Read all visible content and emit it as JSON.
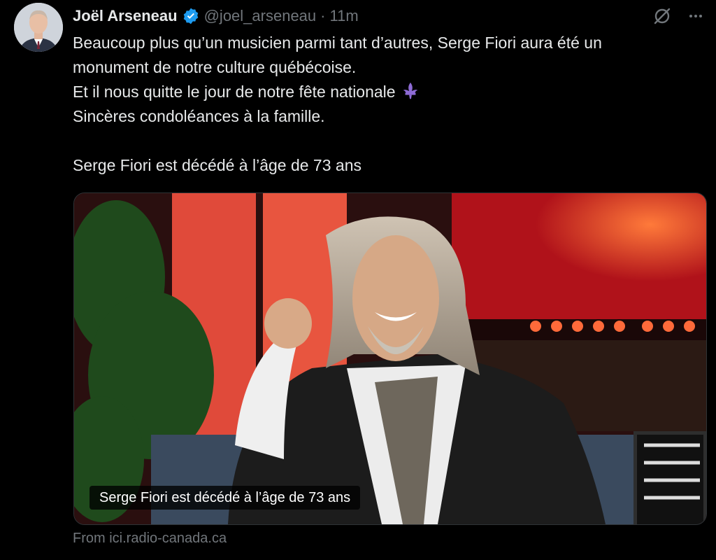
{
  "author": {
    "name": "Joël Arseneau",
    "handle": "@joel_arseneau",
    "separator": "·",
    "time": "11m"
  },
  "tweet": {
    "lines": [
      "Beaucoup plus qu’un musicien parmi tant d’autres, Serge Fiori aura été un",
      "monument de notre culture québécoise.",
      "Et il nous quitte le jour de notre fête nationale",
      "Sincères condoléances à la famille.",
      "Serge Fiori est décédé à l’âge de 73 ans"
    ],
    "emoji": "fleur-de-lis"
  },
  "card": {
    "caption": "Serge Fiori est décédé à l’âge de 73 ans",
    "source": "From ici.radio-canada.ca"
  },
  "icons": {
    "verified": "verified-badge-icon",
    "grok": "grok-icon",
    "more": "more-icon"
  },
  "colors": {
    "background": "#000000",
    "text": "#e7e9ea",
    "muted": "#71767b",
    "verified": "#1d9bf0"
  }
}
